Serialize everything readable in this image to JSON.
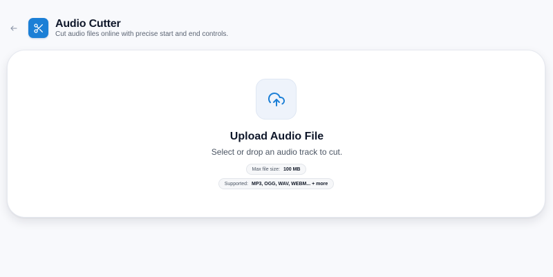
{
  "header": {
    "title": "Audio Cutter",
    "subtitle": "Cut audio files online with precise start and end controls.",
    "back_icon": "arrow-left-icon",
    "app_icon": "scissors-icon",
    "accent_color": "#1b7fd6"
  },
  "upload": {
    "icon": "cloud-upload-icon",
    "title": "Upload Audio File",
    "description": "Select or drop an audio track to cut.",
    "max_size_label": "Max file size:",
    "max_size_value": "100 MB",
    "supported_label": "Supported:",
    "supported_value": "MP3, OGG, WAV, WEBM... + more"
  }
}
